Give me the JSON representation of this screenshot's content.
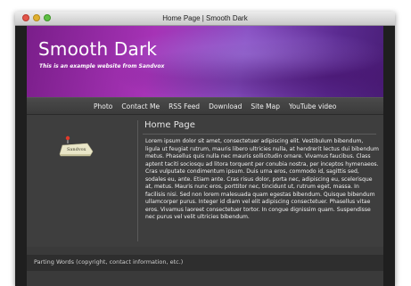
{
  "window": {
    "title": "Home Page | Smooth Dark"
  },
  "header": {
    "site_title": "Smooth Dark",
    "subtitle": "This is an example website from Sandvox"
  },
  "nav": {
    "items": [
      {
        "label": "Photo"
      },
      {
        "label": "Contact Me"
      },
      {
        "label": "RSS Feed"
      },
      {
        "label": "Download"
      },
      {
        "label": "Site Map"
      },
      {
        "label": "YouTube video"
      }
    ]
  },
  "sidebar": {
    "badge_text": "Sandvox"
  },
  "main": {
    "heading": "Home Page",
    "body": "Lorem ipsum dolor sit amet, consectetuer adipiscing elit. Vestibulum bibendum, ligula ut feugiat rutrum, mauris libero ultricies nulla, at hendrerit lectus dui bibendum metus. Phasellus quis nulla nec mauris sollicitudin ornare. Vivamus faucibus. Class aptent taciti sociosqu ad litora torquent per conubia nostra, per inceptos hymenaeos. Cras vulputate condimentum ipsum. Duis urna eros, commodo id, sagittis sed, sodales eu, ante. Etiam ante. Cras risus dolor, porta nec, adipiscing eu, scelerisque at, metus. Mauris nunc eros, porttitor nec, tincidunt ut, rutrum eget, massa. In facilisis nisi. Sed non lorem malesuada quam egestas bibendum. Quisque bibendum ullamcorper purus. Integer id diam vel elit adipiscing consectetuer. Phasellus vitae eros. Vivamus laoreet consectetuer tortor. In congue dignissim quam. Suspendisse nec purus vel velit ultricies bibendum."
  },
  "footer": {
    "text": "Parting Words (copyright, contact information, etc.)"
  },
  "colors": {
    "header_accent": "#a633b6",
    "page_bg": "#3a3a3a",
    "text": "#f2f2f2"
  }
}
